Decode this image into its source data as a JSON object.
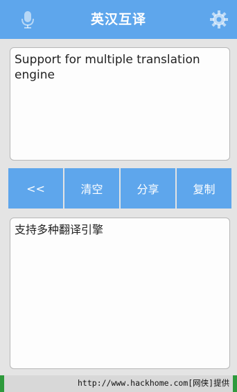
{
  "header": {
    "title": "英汉互译",
    "left_icon": "microphone-icon",
    "right_icon": "gear-icon"
  },
  "input": {
    "text": "Support for multiple translation engine"
  },
  "buttons": {
    "swap_label": "<<",
    "clear_label": "清空",
    "share_label": "分享",
    "copy_label": "复制"
  },
  "output": {
    "text": "支持多种翻译引擎"
  },
  "footer": {
    "text": "http://www.hackhome.com[网侠]提供"
  },
  "colors": {
    "accent": "#5ea6ec",
    "background": "#e4e4e4",
    "footer_green": "#2e9a3c"
  }
}
